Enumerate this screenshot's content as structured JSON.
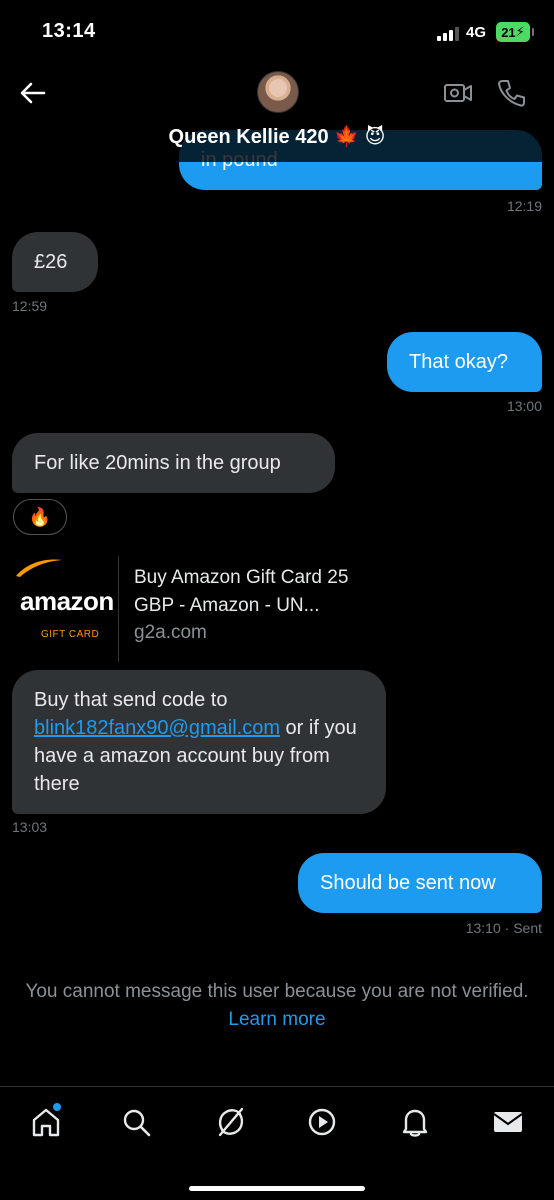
{
  "status_bar": {
    "time": "13:14",
    "network": "4G",
    "battery": "21"
  },
  "header": {
    "contact_name": "Queen Kellie 420 🍁 😈"
  },
  "messages": [
    {
      "direction": "out",
      "text": "in pound",
      "time": "12:19"
    },
    {
      "direction": "in",
      "text": "£26",
      "time": "12:59"
    },
    {
      "direction": "out",
      "text": "That okay?",
      "time": "13:00"
    },
    {
      "direction": "in",
      "text": "For like 20mins in the group",
      "reaction": "🔥"
    },
    {
      "direction": "in",
      "type": "link_card",
      "logo_text": "amazon",
      "logo_sub": "GIFT CARD",
      "title": "Buy Amazon Gift Card 25 GBP - Amazon - UN...",
      "domain": "g2a.com"
    },
    {
      "direction": "in",
      "text_before": "Buy that send code to ",
      "email": "blink182fanx90@gmail.com",
      "text_after": " or if you have a amazon account buy from there",
      "time": "13:03"
    },
    {
      "direction": "out",
      "text": "Should be sent now",
      "time": "13:10",
      "status": "· Sent"
    }
  ],
  "notice": {
    "text": "You cannot message this user because you are not verified.",
    "link": "Learn more"
  },
  "tab_bar": {
    "items": [
      {
        "name": "home",
        "icon": "home-icon",
        "has_dot": true
      },
      {
        "name": "search",
        "icon": "search-icon"
      },
      {
        "name": "grok",
        "icon": "grok-icon"
      },
      {
        "name": "video",
        "icon": "play-icon"
      },
      {
        "name": "notifications",
        "icon": "bell-icon"
      },
      {
        "name": "messages",
        "icon": "envelope-icon"
      }
    ]
  },
  "colors": {
    "accent": "#1d9bf0",
    "bubble_in": "#2f3336",
    "background": "#000000",
    "amazon_orange": "#ff9900"
  }
}
